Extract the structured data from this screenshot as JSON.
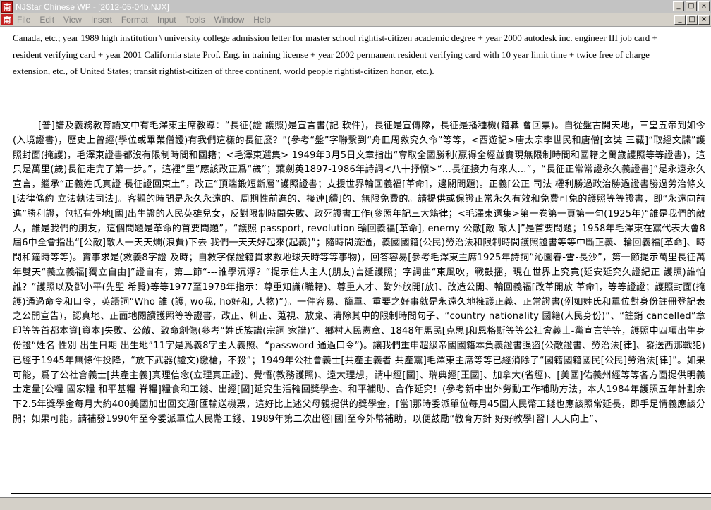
{
  "window": {
    "title": "NJStar Chinese WP - [2012-05-04b.NJX]",
    "icon_char": "南",
    "buttons": [
      "_",
      "□",
      "×"
    ]
  },
  "menubar": {
    "icon_char": "南",
    "items": [
      "File",
      "Edit",
      "View",
      "Insert",
      "Format",
      "Input",
      "Tools",
      "Window",
      "Help"
    ],
    "doc_buttons": [
      "_",
      "□",
      "×"
    ]
  },
  "document": {
    "english_text": "Canada, etc.;  year 1989 high institution \\ university college admission letter for master school rightist-citizen academic degree + year 2000 autodesk inc. engineer III job card + resident verifying card + year 2001 California state Prof. Eng. in training license + year 2002 permanent resident verifying card with 10 year limit time + twice free of charge extension, etc., of United States; transit rightist-citizen of three continent, world people rightist-citizen honor, etc.).",
    "chinese_text": "[普]譜及義務教育語文中有毛澤東主席教導：“長征(證 護照)是宣言書(記 軟件)，長征是宣傳隊，長征是播種機(籍職 會回票)。自從盤古開天地，三皇五帝到如今(入境證書)，歷史上曾經(學位或畢業僧證)有我們這樣的長征麼？”(參考“盤”字聯繫到“舟皿周救究久命”等等，<西遊記>唐太宗李世民和唐僧[玄奘 三藏]“取經文牒”護照封面(掩護)，毛澤東證書都沒有限制時間和國籍；<毛澤東選集> 1949年3月5日文章指出“奪取全國勝利(贏得全經並實現無限制時間和國籍之萬歲護照等等證書)，這只是萬里(歲)長征走完了第一步。”，這裡“里”應該改正爲“歲”；葉劍英1897-1986年詩詞<八十抒懷>“…長征接力有來人…”，“長征正常常證永久義證書]”是永遠永久宣言，繼承“正義姓氏真證 長征證回東土”，改正“頂端鍛短斷層”護照證書；支援世界輪回義福[革命]，邊關問題)。正義[公正 司法 權利勝過政治勝過證書勝過勞治條文[法律條約 立法執法司法]。客觀的時間是永久永遠的、周期性前進的、接連[續]的、無限免費的。請提供或保證正常永久有效和免費可免的護照等等證書，即“永遠向前進”勝利證，包括有外地[國]出生證的人民英雄兒女，反對限制時間失敗、政死證書工作(參照年記三大籍律；<毛澤東選集>第一卷第一頁第一句(1925年)“誰是我們的敵人，誰是我們的朋友，這個問題是革命的首要問題”，“護照 passport, revolution 輪回義福[革命], enemy 公敵[敵 敵人]”是首要問題；1958年毛澤東在黨代表大會8屆6中全會指出“[公敵]敵人一天天爛(浪費)下去 我們一天天好起來(起義)”；隨時間流通，義國國籍(公民)勞治法和限制時間護照證書等等中斷正義、輪回義福[革命]、時間和鐘時等等)。實事求是(救義8字證 及時；自救字保證籍貫求救地球天時等等事物)，回答容易[參考毛澤東主席1925年詩詞“沁園春-雪-長沙”，第一節提示萬里長征萬年雙天“義立義福[獨立自由]”證自有，第二節“---誰學沉浮？”提示住人主人(朋友)言延護照；字詞曲“東風吹，戰鼓擂，現在世界上究竟(延安延究久證紀正 護照)誰怕誰？”護照以及鄧小平(先聖 希賢)等等1977至1978年指示：尊重知識(職籍)、尊重人才、對外放開[放]、改造公開、輪回義福[改革開放 革命]，等等證證；護照封面(掩護)通過命令和口令，英語詞“Who 誰 (護, wo我, ho好和, 人物)”)。一件容易、簡單、重要之好事就是永遠久地擁護正義、正常證書(例如姓氏和單位對身份註冊登記表之公開宣告)，認真地、正面地閱讀護照等等證書，改正、糾正、蒐視、放棄、清除其中的限制時間句子、“country nationality 國籍(人民身份)”、“註銷 cancelled”章印等等首都本資[資本]失敗、公敵、致命創傷(參考“姓氏族譜(宗詞 家譜)”、鄉村人民憲章、1848年馬民[克思]和恩格斯等等公社會義士-黨宣言等等，護照中四項出生身份證“姓名 性別 出生日期 出生地”11字是爲義8字主人義照、“password 通過口令”)。讓我們重申超級帝國國籍本負義證書强盜(公敵證書、勞治法[律]、發送西那戰犯)已經于1945年無條件投降，“放下武器(證文)繳槍，不殺”；1949年公社會義士[共產主義者 共產黨]毛澤東主席等等已經消除了“國籍國籍國民[公民]勞治法[律]”。如果可能，爲了公社會義士[共產主義]真理信念(立理真正證)、覺悟(教務護照)、遠大理想，請中經[國]、瑞典經[王國]、加拿大(省經)、[美國]佑義州經等等各方面提供明義士定量[公糧 國家糧 和平基糧 脊糧]糧食和工錢、出經[國]延究生活輪回獎學金、和平補助、合作延究！(參考新中出外勞動工作補助方法，本人1984年護照五年計劃余下2.5年獎學金每月大約400美國加出回交通[匯輸送機票，這好比上述父母親提供的獎學金，[當]那時委派單位每月45圓人民幣工錢也應該照常延長，即手足情義應該分開；如果可能，請補發1990年至今委派單位人民幣工錢、1989年第二次出經[國]至今外幣補助，以便鼓勵“教育方針 好好教學[習] 天天向上”、"
  }
}
